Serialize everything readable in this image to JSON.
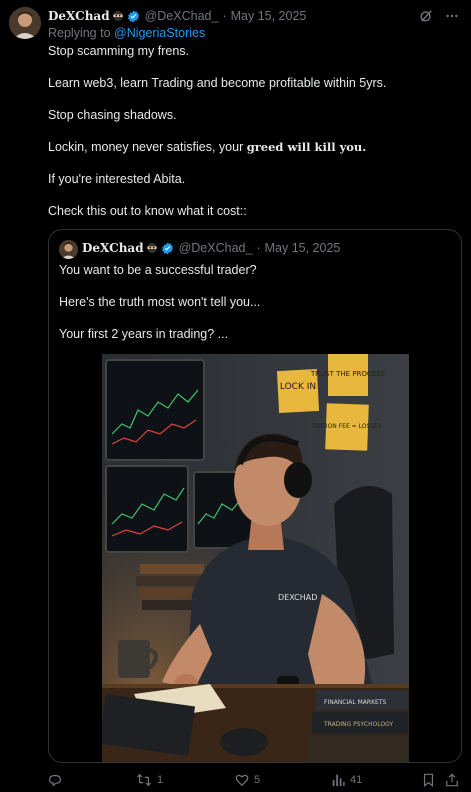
{
  "tweet": {
    "author_name": "DeXChad",
    "author_handle": "@DeXChad_",
    "separator": "·",
    "date": "May 15, 2025",
    "replying_prefix": "Replying to",
    "replying_to": "@NigeriaStories",
    "lines": {
      "l1": "Stop scamming my frens.",
      "l2": "Learn web3, learn Trading and become profitable within 5yrs.",
      "l3": "Stop chasing shadows.",
      "l4_start": "Lockin, money never satisfies, your ",
      "l4_bold": "greed will kill you.",
      "l5": "If you're interested Abita.",
      "l6": "Check this out to know what it cost::"
    }
  },
  "quoted": {
    "author_name": "DeXChad",
    "author_handle": "@DeXChad_",
    "separator": "·",
    "date": "May 15, 2025",
    "lines": {
      "l1": "You want to be a successful trader?",
      "l2": "Here's the truth most won't tell you...",
      "l3": "Your first 2 years in trading? ..."
    },
    "image": {
      "note1": "LOCK IN",
      "note2": "TRUST THE PROCESS",
      "note3": "TUITION FEE = LOSSES",
      "shirt": "DEXCHAD",
      "book1": "FINANCIAL MARKETS",
      "book2": "TRADING PSYCHOLOGY"
    }
  },
  "actions": {
    "reply_count": "",
    "repost_count": "1",
    "like_count": "5",
    "views_count": "41"
  },
  "colors": {
    "background": "#000000",
    "text": "#e7e9ea",
    "muted": "#71767b",
    "link": "#1d9bf0",
    "border": "#2f3336"
  }
}
